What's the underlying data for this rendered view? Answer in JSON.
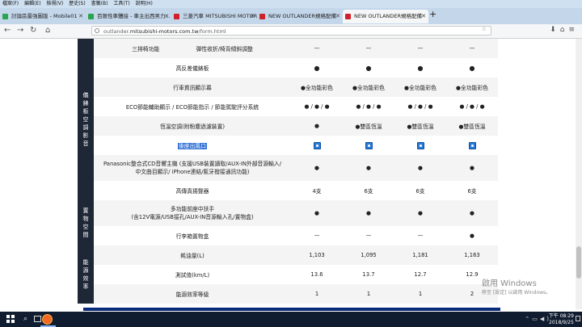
{
  "browser": {
    "menu": [
      "檔案(F)",
      "編輯(E)",
      "檢視(V)",
      "歷史(S)",
      "書籤(B)",
      "工具(T)",
      "說明(H)"
    ],
    "tabs": [
      {
        "label": "討論區最強圖版 - Mobile01",
        "icon_color": "#2aa44f",
        "active": false
      },
      {
        "label": "百匯性車體接 - 車主出西男力...",
        "icon_color": "#2aa44f",
        "active": false
      },
      {
        "label": "三菱汽車 MITSUBISHI MOTORS",
        "icon_color": "#d0202a",
        "active": false
      },
      {
        "label": "NEW OUTLANDER規格配備",
        "icon_color": "#d0202a",
        "active": false
      },
      {
        "label": "NEW OUTLANDER規格配備",
        "icon_color": "#d0202a",
        "active": true
      }
    ],
    "url_prefix": "outlander.",
    "url_domain": "mitsubishi-motors.com.tw",
    "url_suffix": "/form.html"
  },
  "table": {
    "rows": [
      {
        "label": "三排椅功能                     彈性收折/椅背傾斜調整",
        "cells": [
          "—",
          "—",
          "—",
          "—"
        ]
      },
      {
        "label": "高反差儀錶板",
        "cells": [
          "●",
          "●",
          "●",
          "●"
        ]
      },
      {
        "label": "行車資訊顯示幕",
        "cells": [
          "●全功能彩色",
          "●全功能彩色",
          "●全功能彩色",
          "●全功能彩色"
        ]
      },
      {
        "label": "ECO節能輔助顯示 / ECO節能指示 / 節能駕駛評分系統",
        "cells": [
          "● / ● / ●",
          "● / ● / ●",
          "● / ● / ●",
          "● / ● / ●"
        ]
      },
      {
        "label": "恆溫空調(附粉塵過濾裝置)",
        "cells": [
          "●",
          "●雙區恆溫",
          "●雙區恆溫",
          "●雙區恆溫"
        ]
      },
      {
        "label": "後座出風口",
        "cells": [
          "",
          "",
          "",
          ""
        ],
        "selected": true
      },
      {
        "label": "Panasonic整合式CD音響主機 (支援USB裝置讀取/AUX-IN外部音源輸入/中文曲目顯示/ iPhone連結/藍牙撥接通訊功能)",
        "cells": [
          "●",
          "●",
          "●",
          "●"
        ]
      },
      {
        "label": "高傳真揚聲器",
        "cells": [
          "4支",
          "6支",
          "6支",
          "6支"
        ]
      },
      {
        "label": "多功能前座中扶手\n(含12V電源/USB接孔/AUX-IN音源輸入孔/置物盒)",
        "cells": [
          "●",
          "●",
          "●",
          "●"
        ]
      },
      {
        "label": "行李箱置物盒",
        "cells": [
          "—",
          "—",
          "—",
          "●"
        ]
      },
      {
        "label": "耗油量(L)",
        "cells": [
          "1,103",
          "1,095",
          "1,181",
          "1,163"
        ]
      },
      {
        "label": "測試值(km/L)",
        "cells": [
          "13.6",
          "13.7",
          "12.7",
          "12.9"
        ]
      },
      {
        "label": "能源效率等級",
        "cells": [
          "1",
          "1",
          "1",
          "2"
        ]
      }
    ],
    "categories": [
      {
        "text": "儀錶板空調影音"
      },
      {
        "text": "置物空間"
      },
      {
        "text": "能源效率"
      }
    ]
  },
  "watermark": {
    "title": "啟用 Windows",
    "subtitle": "移至 [設定] 以啟用 Windows。"
  },
  "taskbar": {
    "time": "下午 08:29",
    "date": "2018/9/25"
  }
}
